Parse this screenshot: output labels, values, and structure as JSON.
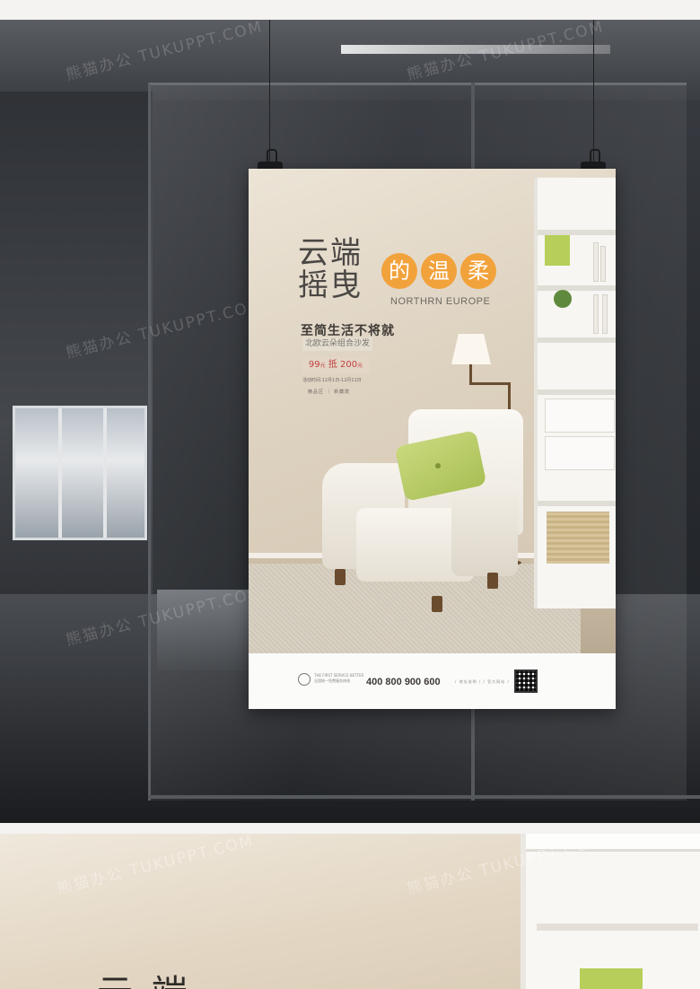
{
  "watermark": {
    "text": "熊猫办公 TUKUPPT.COM"
  },
  "poster": {
    "headline_line1": "云端",
    "headline_line2": "摇曳",
    "circles": [
      "的",
      "温",
      "柔"
    ],
    "subtitle_en": "NORTHRN EUROPE",
    "tagline": "至简生活不将就",
    "sub_tag": "北欧云朵组合沙发",
    "price": {
      "amount1": "99",
      "unit1": "元",
      "connector": "抵",
      "amount2": "200",
      "unit2": "元"
    },
    "event_time": "活动时间:12月1日-12月11日",
    "event_tags": "精品区 ｜ 新藏款",
    "footer": {
      "brand_line1": "THE FIRST SERVICE BETTER",
      "brand_line2": "全国统一免费服务热线",
      "phone": "400 800 900 600",
      "info": "/ 地址说明 /  / 官方网站 /"
    }
  },
  "colors": {
    "accent_orange": "#f2a23b",
    "price_red": "#c04040",
    "pillow_green": "#a9bf55"
  },
  "detail": {
    "headline": "云 端"
  }
}
